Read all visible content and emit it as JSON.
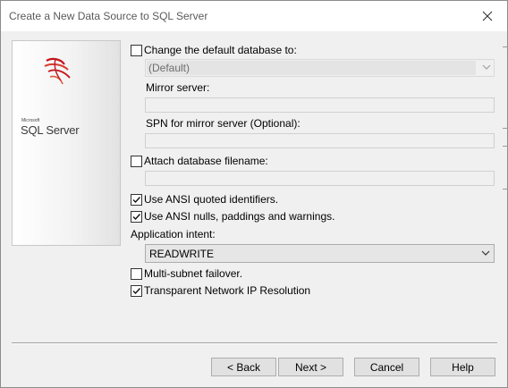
{
  "window": {
    "title": "Create a New Data Source to SQL Server"
  },
  "logo": {
    "microsoft": "Microsoft",
    "product": "SQL Server"
  },
  "options": {
    "change_default_db": {
      "label": "Change the default database to:",
      "checked": false
    },
    "default_db_combo": {
      "value": "(Default)"
    },
    "mirror_server": {
      "label": "Mirror server:",
      "value": ""
    },
    "spn_mirror": {
      "label": "SPN for mirror server (Optional):",
      "value": ""
    },
    "attach_db": {
      "label": "Attach database filename:",
      "checked": false,
      "value": ""
    },
    "ansi_quoted": {
      "label": "Use ANSI quoted identifiers.",
      "checked": true
    },
    "ansi_nulls": {
      "label": "Use ANSI nulls, paddings and warnings.",
      "checked": true
    },
    "app_intent": {
      "label": "Application intent:",
      "value": "READWRITE"
    },
    "multi_subnet": {
      "label": "Multi-subnet failover.",
      "checked": false
    },
    "tnir": {
      "label": "Transparent Network IP Resolution",
      "checked": true
    }
  },
  "buttons": {
    "back": "< Back",
    "next": "Next >",
    "cancel": "Cancel",
    "help": "Help"
  }
}
